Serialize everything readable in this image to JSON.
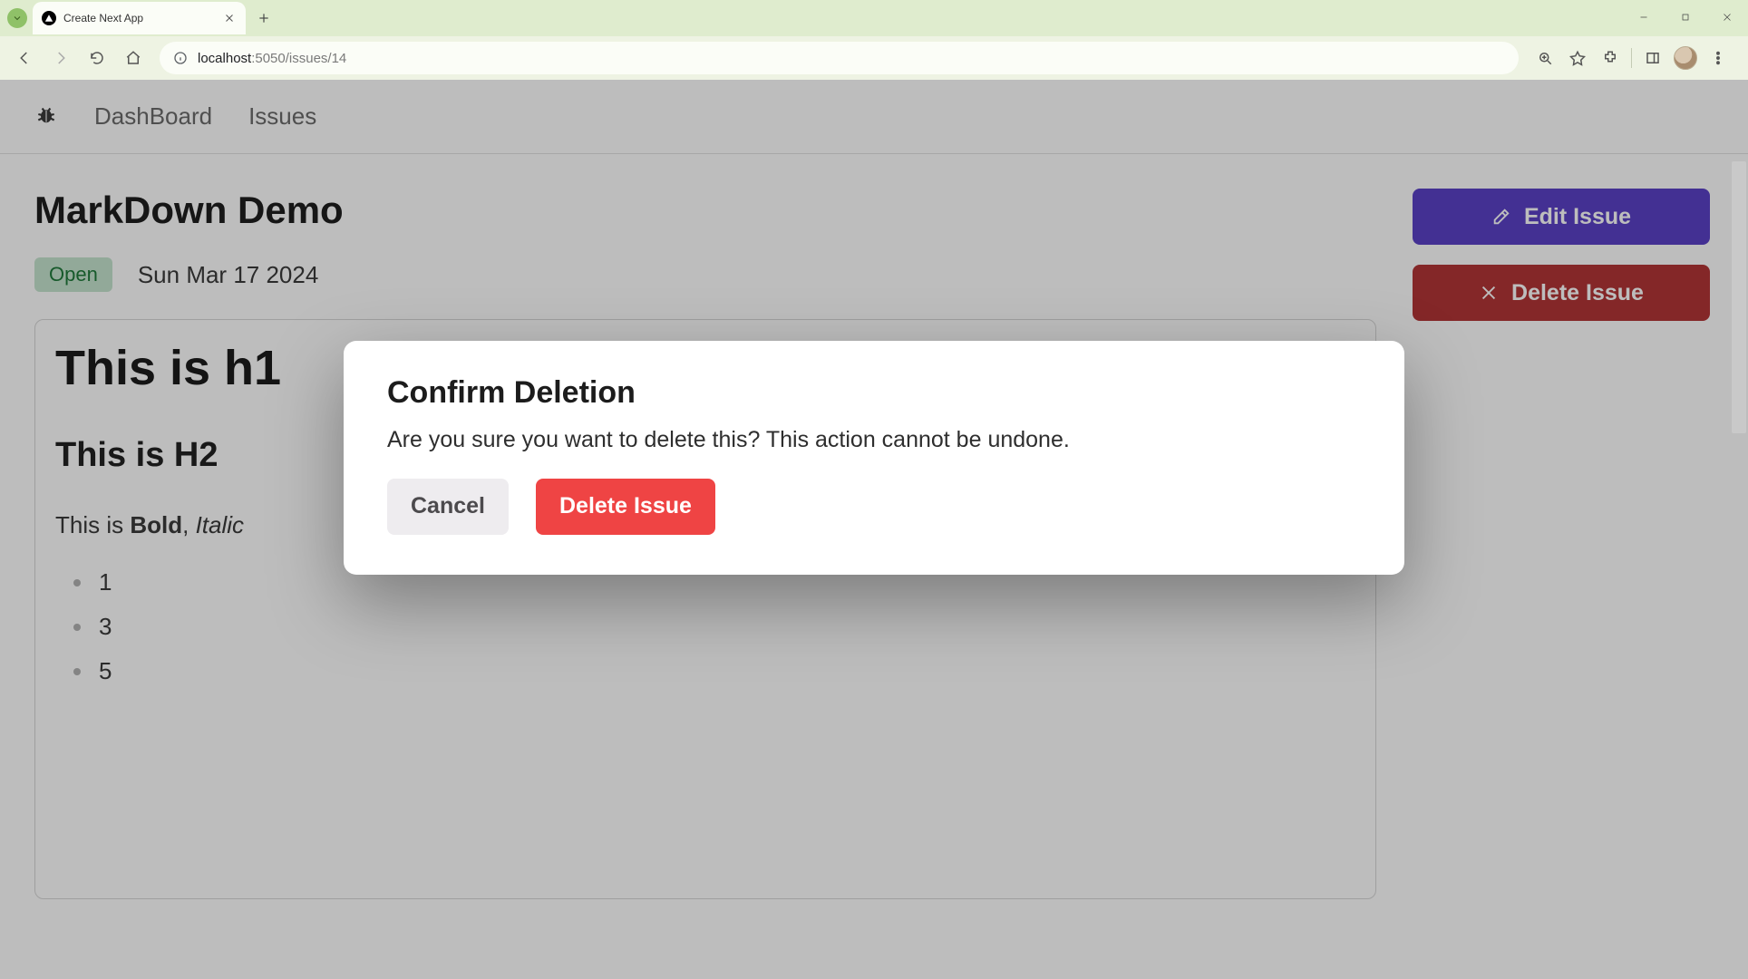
{
  "browser": {
    "tab_title": "Create Next App",
    "url_host": "localhost",
    "url_port_path": ":5050/issues/14"
  },
  "header": {
    "nav": {
      "dashboard": "DashBoard",
      "issues": "Issues"
    }
  },
  "issue": {
    "title": "MarkDown Demo",
    "status_badge": "Open",
    "date": "Sun Mar 17 2024"
  },
  "markdown": {
    "h1": "This is h1",
    "h2": "This is H2",
    "line_prefix": "This is ",
    "bold": "Bold",
    "sep": ", ",
    "italic": "Italic",
    "list": [
      "1",
      "3",
      "5"
    ]
  },
  "actions": {
    "edit_label": "Edit Issue",
    "delete_label": "Delete Issue"
  },
  "modal": {
    "title": "Confirm Deletion",
    "text": "Are you sure you want to delete this? This action cannot be undone.",
    "cancel": "Cancel",
    "confirm": "Delete Issue"
  }
}
